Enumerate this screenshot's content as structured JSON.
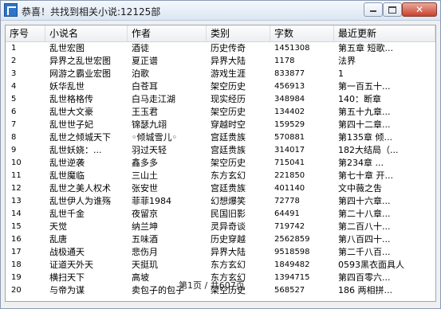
{
  "window": {
    "title": "恭喜！共找到相关小说:12125部",
    "controls": {
      "close": "✕"
    }
  },
  "table": {
    "columns": [
      "序号",
      "小说名",
      "作者",
      "类别",
      "字数",
      "最近更新"
    ],
    "rows": [
      [
        "1",
        "乱世宏图",
        "酒徒",
        "历史传奇",
        "1451308",
        "第五章 短歌..."
      ],
      [
        "2",
        "异界之乱世宏图",
        "夏正谱",
        "异界大陆",
        "1178",
        "法界"
      ],
      [
        "3",
        "网游之霸业宏图",
        "泊歌",
        "游戏生涯",
        "833877",
        "1"
      ],
      [
        "4",
        "妖华乱世",
        "白苍耳",
        "架空历史",
        "456913",
        "第一百五十..."
      ],
      [
        "5",
        "乱世格格传",
        "白马走江湖",
        "现实经历",
        "348984",
        "140：断章"
      ],
      [
        "6",
        "乱世大文豪",
        "王玉君",
        "架空历史",
        "134402",
        "第五十九章..."
      ],
      [
        "7",
        "乱世世子妃",
        "锦瑟九翊",
        "穿越时空",
        "159529",
        "第四十二章..."
      ],
      [
        "8",
        "乱世之倾城天下",
        "◦倾城雪儿◦",
        "宫廷贵族",
        "570881",
        "第135章 倾..."
      ],
      [
        "9",
        "乱世妖娆：...",
        "羽过天轻",
        "宫廷贵族",
        "314017",
        "182大结局（..."
      ],
      [
        "10",
        "乱世逆袭",
        "鑫多多",
        "架空历史",
        "715041",
        "第234章 ..."
      ],
      [
        "11",
        "乱世魔临",
        "三山土",
        "东方玄幻",
        "221850",
        "第七十章 开..."
      ],
      [
        "12",
        "乱世之美人权术",
        "张安世",
        "宫廷贵族",
        "401140",
        "文中薇之吿"
      ],
      [
        "13",
        "乱世伊人为谁殇",
        "菲菲1984",
        "幻想爆笑",
        "72778",
        "第四十六章..."
      ],
      [
        "14",
        "乱世千金",
        "夜留京",
        "民国旧影",
        "64491",
        "第二十八章..."
      ],
      [
        "15",
        "天觉",
        "纳兰坤",
        "灵异奇谈",
        "719742",
        "第二百八十..."
      ],
      [
        "16",
        "乱唐",
        "五味酒",
        "历史穿越",
        "2562859",
        "第八百四十..."
      ],
      [
        "17",
        "战极通天",
        "悲伤月",
        "异界大陆",
        "9518598",
        "第二千八百..."
      ],
      [
        "18",
        "证道天外天",
        "天挺玑",
        "东方玄幻",
        "1849482",
        "0593黑衣面具人"
      ],
      [
        "19",
        "横扫天下",
        "高坡",
        "东方玄幻",
        "1394715",
        "第四百零六..."
      ],
      [
        "20",
        "与帝为谋",
        "卖包子的包子",
        "架空历史",
        "568527",
        "186 两相拼..."
      ]
    ]
  },
  "status": {
    "text": "第1页 / 共607页"
  }
}
